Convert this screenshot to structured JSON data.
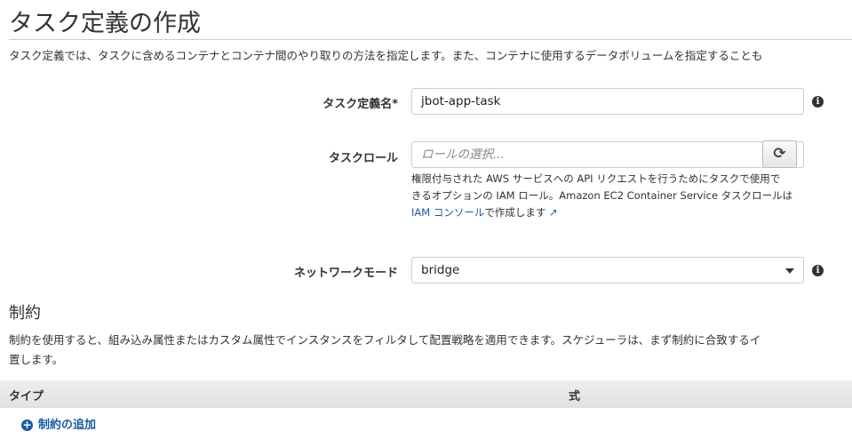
{
  "title": "タスク定義の作成",
  "description": "タスク定義では、タスクに含めるコンテナとコンテナ間のやり取りの方法を指定します。また、コンテナに使用するデータボリュームを指定することも",
  "task_name": {
    "label": "タスク定義名*",
    "value": "jbot-app-task"
  },
  "task_role": {
    "label": "タスクロール",
    "placeholder": "ロールの選択...",
    "help_line1": "権限付与された AWS サービスへの API リクエストを行うためにタスクで使用で",
    "help_line2": "きるオプションの IAM ロール。Amazon EC2 Container Service タスクロールは",
    "help_link": "IAM コンソール",
    "help_tail": "で作成します"
  },
  "network_mode": {
    "label": "ネットワークモード",
    "value": "bridge"
  },
  "constraints": {
    "heading": "制約",
    "desc_line1": "制約を使用すると、組み込み属性またはカスタム属性でインスタンスをフィルタして配置戦略を適用できます。スケジューラは、まず制約に合致するイ",
    "desc_line2": "置します。",
    "columns": [
      "タイプ",
      "式"
    ],
    "add_label": "制約の追加"
  },
  "colors": {
    "link": "#1a5ba6"
  }
}
